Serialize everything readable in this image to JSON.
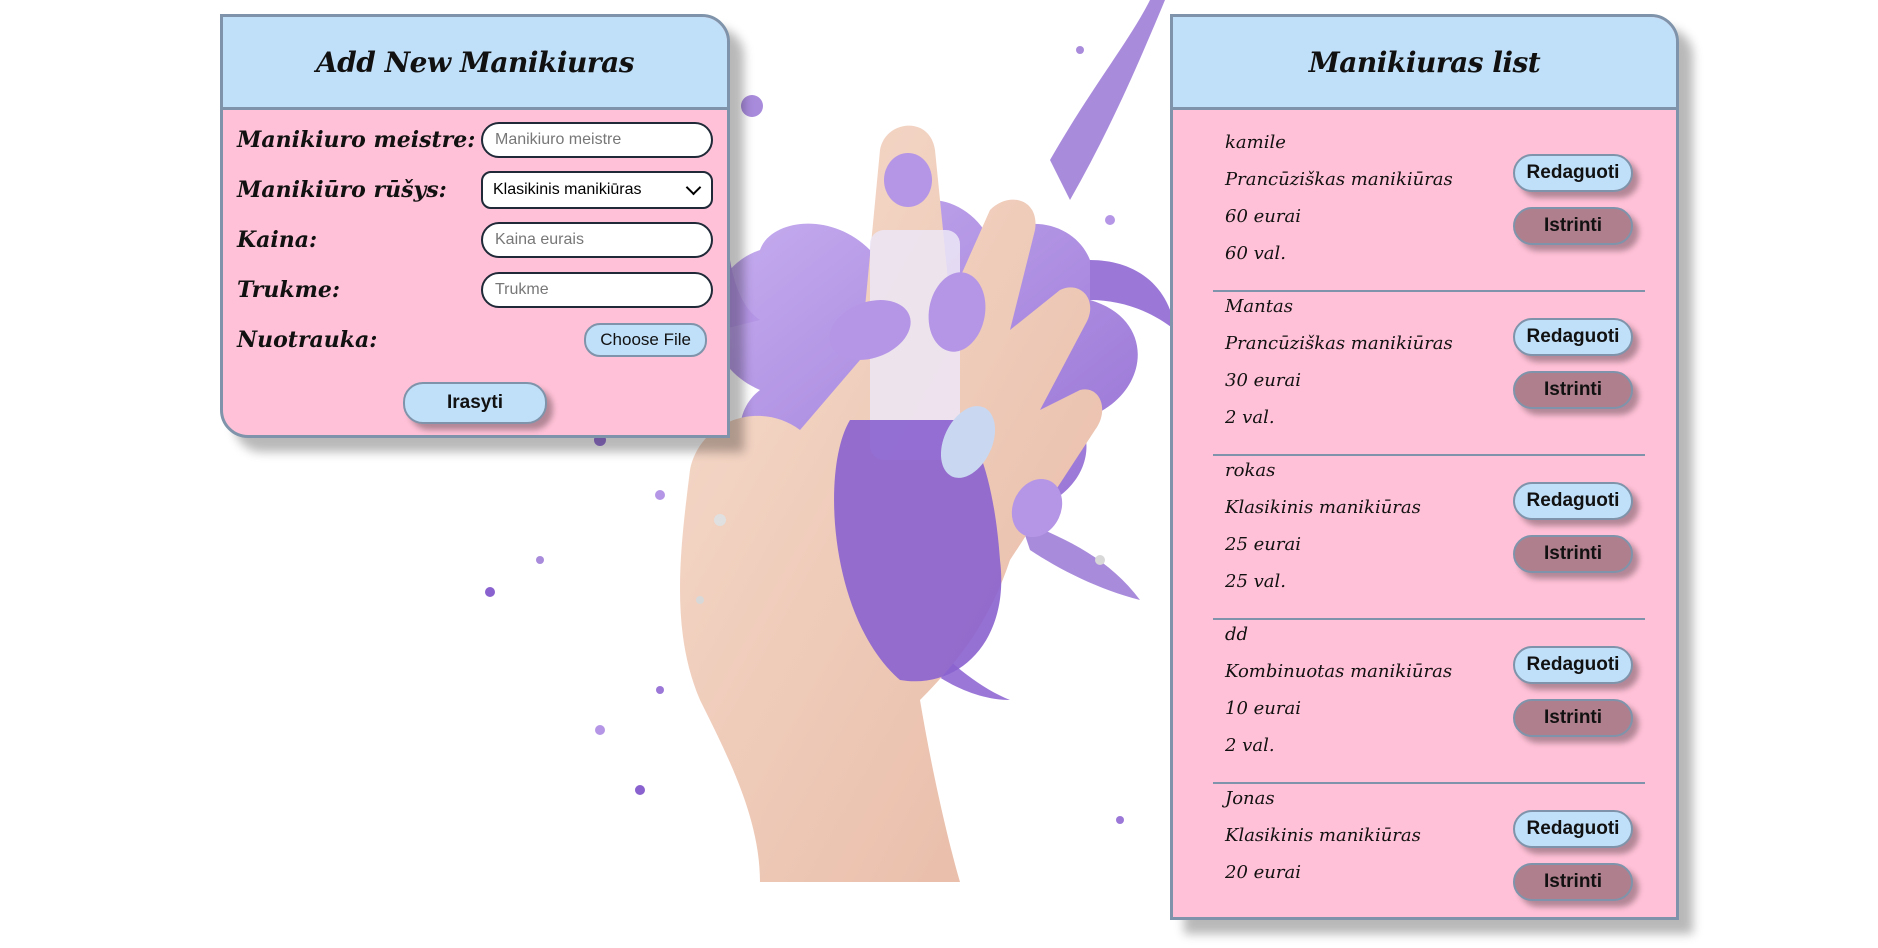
{
  "form": {
    "title": "Add New Manikiuras",
    "fields": [
      {
        "label": "Manikiuro meistre:",
        "placeholder": "Manikiuro meistre"
      },
      {
        "label": "Manikiūro rūšys:",
        "value": "Klasikinis manikiūras"
      },
      {
        "label": "Kaina:",
        "placeholder": "Kaina eurais"
      },
      {
        "label": "Trukme:",
        "placeholder": "Trukme"
      },
      {
        "label": "Nuotrauka:",
        "button": "Choose File"
      }
    ],
    "submit_label": "Irasyti"
  },
  "list": {
    "title": "Manikiuras list",
    "edit_label": "Redaguoti",
    "delete_label": "Istrinti",
    "items": [
      {
        "meistre": "kamile",
        "rusis": "Prancūziškas manikiūras",
        "kaina": "60 eurai",
        "trukme": "60 val."
      },
      {
        "meistre": "Mantas",
        "rusis": "Prancūziškas manikiūras",
        "kaina": "30 eurai",
        "trukme": "2 val."
      },
      {
        "meistre": "rokas",
        "rusis": "Klasikinis manikiūras",
        "kaina": "25 eurai",
        "trukme": "25 val."
      },
      {
        "meistre": "dd",
        "rusis": "Kombinuotas manikiūras",
        "kaina": "10 eurai",
        "trukme": "2 val."
      },
      {
        "meistre": "Jonas",
        "rusis": "Klasikinis manikiūras",
        "kaina": "20 eurai",
        "trukme": ""
      }
    ]
  },
  "colors": {
    "panel_bg": "#ffc1d7",
    "header_bg": "#c0dff8",
    "border": "#7f94aa",
    "delete_bg": "#b07f8d",
    "paint": "#a98bdc"
  },
  "background_image": "hand-with-purple-nail-polish-splash"
}
